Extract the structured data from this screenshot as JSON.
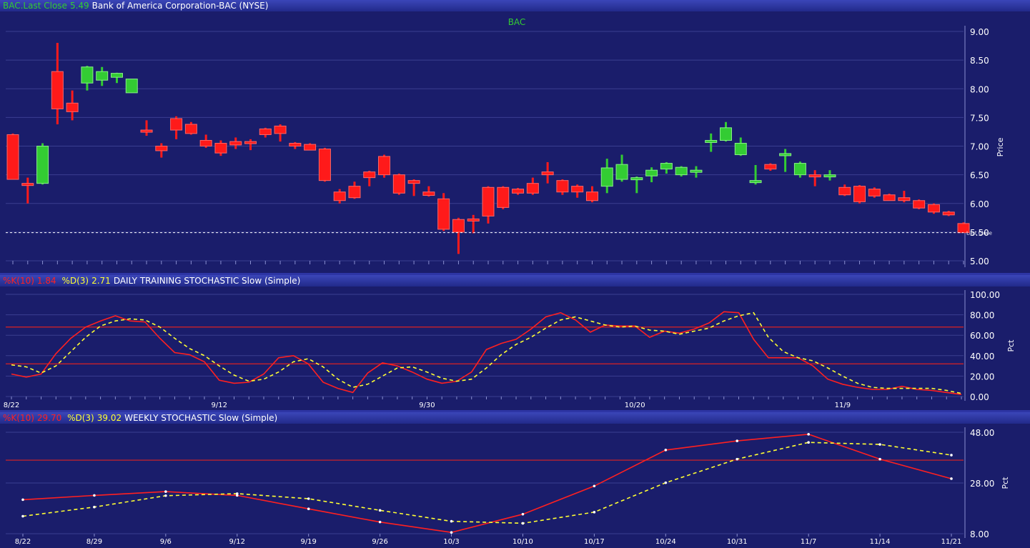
{
  "header": {
    "symbol_label": "BAC.Last Close",
    "last_close": "5.49",
    "name": "Bank of America Corporation-BAC (NYSE)"
  },
  "colors": {
    "background": "#1a1d6b",
    "grid": "#3a3f90",
    "up": "#33cc33",
    "down": "#ff1a1a",
    "k_line": "#ff2020",
    "d_line": "#ffff33",
    "ref_line": "#dd2222"
  },
  "price_panel": {
    "title": "BAC",
    "y_axis_label": "Price",
    "last_close_label": "Last Close",
    "y_ticks": [
      "9.00",
      "8.50",
      "8.00",
      "7.50",
      "7.00",
      "6.50",
      "6.00",
      "5.50",
      "5.00"
    ]
  },
  "daily_panel": {
    "k_label": "%K(10)",
    "k_value": "1.84",
    "d_label": "%D(3)",
    "d_value": "2.71",
    "title": "DAILY TRAINING STOCHASTIC Slow (Simple)",
    "y_axis_label": "Pct",
    "y_ticks": [
      "100.00",
      "80.00",
      "60.00",
      "40.00",
      "20.00",
      "0.00"
    ],
    "x_ticks": [
      "8/22",
      "9/12",
      "9/30",
      "10/20",
      "11/9"
    ]
  },
  "weekly_panel": {
    "k_label": "%K(10)",
    "k_value": "29.70",
    "d_label": "%D(3)",
    "d_value": "39.02",
    "title": "WEEKLY STOCHASTIC Slow (Simple)",
    "y_axis_label": "Pct",
    "y_ticks": [
      "48.00",
      "28.00",
      "8.00"
    ],
    "x_ticks": [
      "8/22",
      "8/29",
      "9/6",
      "9/12",
      "9/19",
      "9/26",
      "10/3",
      "10/10",
      "10/17",
      "10/24",
      "10/31",
      "11/7",
      "11/14",
      "11/21"
    ]
  },
  "chart_data": [
    {
      "type": "candlestick",
      "title": "BAC",
      "ylabel": "Price",
      "ylim": [
        5.0,
        9.0
      ],
      "last_close": 5.49,
      "grid": true,
      "candles": [
        {
          "o": 7.2,
          "h": 7.22,
          "l": 6.42,
          "c": 6.42
        },
        {
          "o": 6.35,
          "h": 6.45,
          "l": 6.0,
          "c": 6.32
        },
        {
          "o": 6.35,
          "h": 7.05,
          "l": 6.33,
          "c": 7.0
        },
        {
          "o": 8.3,
          "h": 8.8,
          "l": 7.38,
          "c": 7.65
        },
        {
          "o": 7.75,
          "h": 7.97,
          "l": 7.45,
          "c": 7.6
        },
        {
          "o": 8.1,
          "h": 8.4,
          "l": 7.97,
          "c": 8.38
        },
        {
          "o": 8.15,
          "h": 8.38,
          "l": 8.05,
          "c": 8.3
        },
        {
          "o": 8.2,
          "h": 8.28,
          "l": 8.1,
          "c": 8.27
        },
        {
          "o": 7.93,
          "h": 8.17,
          "l": 7.93,
          "c": 8.17
        },
        {
          "o": 7.28,
          "h": 7.45,
          "l": 7.18,
          "c": 7.25
        },
        {
          "o": 7.0,
          "h": 7.05,
          "l": 6.8,
          "c": 6.92
        },
        {
          "o": 7.48,
          "h": 7.52,
          "l": 7.12,
          "c": 7.28
        },
        {
          "o": 7.38,
          "h": 7.42,
          "l": 7.2,
          "c": 7.22
        },
        {
          "o": 7.1,
          "h": 7.2,
          "l": 6.97,
          "c": 7.0
        },
        {
          "o": 7.05,
          "h": 7.1,
          "l": 6.83,
          "c": 6.88
        },
        {
          "o": 7.08,
          "h": 7.15,
          "l": 6.95,
          "c": 7.02
        },
        {
          "o": 7.08,
          "h": 7.12,
          "l": 6.93,
          "c": 7.05
        },
        {
          "o": 7.3,
          "h": 7.32,
          "l": 7.15,
          "c": 7.2
        },
        {
          "o": 7.35,
          "h": 7.38,
          "l": 7.08,
          "c": 7.22
        },
        {
          "o": 7.05,
          "h": 7.07,
          "l": 6.95,
          "c": 7.0
        },
        {
          "o": 7.03,
          "h": 7.05,
          "l": 6.93,
          "c": 6.93
        },
        {
          "o": 6.95,
          "h": 6.97,
          "l": 6.38,
          "c": 6.4
        },
        {
          "o": 6.2,
          "h": 6.25,
          "l": 6.0,
          "c": 6.05
        },
        {
          "o": 6.3,
          "h": 6.38,
          "l": 6.08,
          "c": 6.1
        },
        {
          "o": 6.55,
          "h": 6.57,
          "l": 6.3,
          "c": 6.45
        },
        {
          "o": 6.82,
          "h": 6.85,
          "l": 6.45,
          "c": 6.5
        },
        {
          "o": 6.5,
          "h": 6.52,
          "l": 6.15,
          "c": 6.18
        },
        {
          "o": 6.4,
          "h": 6.42,
          "l": 6.13,
          "c": 6.35
        },
        {
          "o": 6.2,
          "h": 6.3,
          "l": 6.12,
          "c": 6.14
        },
        {
          "o": 6.08,
          "h": 6.18,
          "l": 5.52,
          "c": 5.55
        },
        {
          "o": 5.72,
          "h": 5.75,
          "l": 5.12,
          "c": 5.5
        },
        {
          "o": 5.73,
          "h": 5.8,
          "l": 5.48,
          "c": 5.72
        },
        {
          "o": 6.28,
          "h": 6.3,
          "l": 5.65,
          "c": 5.78
        },
        {
          "o": 6.28,
          "h": 6.3,
          "l": 5.9,
          "c": 5.93
        },
        {
          "o": 6.25,
          "h": 6.27,
          "l": 6.15,
          "c": 6.18
        },
        {
          "o": 6.35,
          "h": 6.45,
          "l": 6.15,
          "c": 6.18
        },
        {
          "o": 6.55,
          "h": 6.72,
          "l": 6.35,
          "c": 6.5
        },
        {
          "o": 6.4,
          "h": 6.42,
          "l": 6.15,
          "c": 6.2
        },
        {
          "o": 6.3,
          "h": 6.33,
          "l": 6.1,
          "c": 6.2
        },
        {
          "o": 6.2,
          "h": 6.3,
          "l": 6.02,
          "c": 6.05
        },
        {
          "o": 6.3,
          "h": 6.78,
          "l": 6.18,
          "c": 6.62
        },
        {
          "o": 6.42,
          "h": 6.85,
          "l": 6.38,
          "c": 6.68
        },
        {
          "o": 6.45,
          "h": 6.47,
          "l": 6.18,
          "c": 6.45
        },
        {
          "o": 6.48,
          "h": 6.63,
          "l": 6.37,
          "c": 6.58
        },
        {
          "o": 6.6,
          "h": 6.72,
          "l": 6.52,
          "c": 6.7
        },
        {
          "o": 6.5,
          "h": 6.65,
          "l": 6.47,
          "c": 6.63
        },
        {
          "o": 6.55,
          "h": 6.65,
          "l": 6.45,
          "c": 6.58
        },
        {
          "o": 7.08,
          "h": 7.22,
          "l": 6.9,
          "c": 7.1
        },
        {
          "o": 7.1,
          "h": 7.42,
          "l": 7.08,
          "c": 7.32
        },
        {
          "o": 6.85,
          "h": 7.15,
          "l": 6.83,
          "c": 7.05
        },
        {
          "o": 6.4,
          "h": 6.67,
          "l": 6.33,
          "c": 6.4
        },
        {
          "o": 6.68,
          "h": 6.7,
          "l": 6.57,
          "c": 6.6
        },
        {
          "o": 6.85,
          "h": 6.95,
          "l": 6.55,
          "c": 6.87
        },
        {
          "o": 6.5,
          "h": 6.73,
          "l": 6.45,
          "c": 6.7
        },
        {
          "o": 6.5,
          "h": 6.58,
          "l": 6.3,
          "c": 6.48
        },
        {
          "o": 6.5,
          "h": 6.58,
          "l": 6.4,
          "c": 6.5
        },
        {
          "o": 6.28,
          "h": 6.33,
          "l": 6.13,
          "c": 6.15
        },
        {
          "o": 6.3,
          "h": 6.32,
          "l": 6.0,
          "c": 6.03
        },
        {
          "o": 6.25,
          "h": 6.28,
          "l": 6.1,
          "c": 6.13
        },
        {
          "o": 6.15,
          "h": 6.17,
          "l": 6.05,
          "c": 6.05
        },
        {
          "o": 6.1,
          "h": 6.22,
          "l": 6.02,
          "c": 6.05
        },
        {
          "o": 6.05,
          "h": 6.07,
          "l": 5.9,
          "c": 5.92
        },
        {
          "o": 5.98,
          "h": 6.0,
          "l": 5.82,
          "c": 5.85
        },
        {
          "o": 5.85,
          "h": 5.87,
          "l": 5.78,
          "c": 5.8
        },
        {
          "o": 5.65,
          "h": 5.67,
          "l": 5.49,
          "c": 5.49
        }
      ]
    },
    {
      "type": "line",
      "title": "DAILY TRAINING STOCHASTIC Slow (Simple)",
      "ylabel": "Pct",
      "ylim": [
        0,
        100
      ],
      "reference_lines": [
        68,
        32
      ],
      "series": [
        {
          "name": "%K(10)",
          "values": [
            22,
            19,
            22,
            42,
            57,
            68,
            74,
            79,
            74,
            73,
            57,
            43,
            41,
            34,
            16,
            13,
            14,
            22,
            38,
            40,
            32,
            14,
            8,
            4,
            23,
            33,
            30,
            24,
            17,
            13,
            15,
            24,
            46,
            52,
            56,
            66,
            78,
            82,
            75,
            63,
            70,
            69,
            69,
            58,
            64,
            62,
            66,
            72,
            83,
            82,
            56,
            38,
            38,
            38,
            30,
            17,
            12,
            9,
            7,
            7,
            10,
            7,
            6,
            4,
            2
          ]
        },
        {
          "name": "%D(3)",
          "values": [
            31,
            29,
            23,
            30,
            44,
            58,
            69,
            74,
            76,
            75,
            68,
            57,
            47,
            40,
            30,
            21,
            15,
            17,
            24,
            34,
            37,
            29,
            17,
            9,
            12,
            20,
            28,
            29,
            24,
            18,
            15,
            17,
            28,
            41,
            51,
            58,
            67,
            75,
            78,
            74,
            70,
            68,
            69,
            65,
            64,
            61,
            64,
            67,
            74,
            79,
            82,
            58,
            44,
            38,
            35,
            28,
            20,
            13,
            9,
            8,
            8,
            8,
            8,
            6,
            3
          ]
        }
      ]
    },
    {
      "type": "line",
      "title": "WEEKLY STOCHASTIC Slow (Simple)",
      "ylabel": "Pct",
      "ylim": [
        8,
        48
      ],
      "reference_line": 37,
      "categories": [
        "8/22",
        "8/29",
        "9/6",
        "9/12",
        "9/19",
        "9/26",
        "10/3",
        "10/10",
        "10/17",
        "10/24",
        "10/31",
        "11/7",
        "11/14",
        "11/21"
      ],
      "series": [
        {
          "name": "%K(10)",
          "values": [
            21.4,
            23.1,
            24.6,
            23.1,
            17.8,
            12.6,
            8.5,
            15.7,
            26.8,
            41.0,
            44.6,
            47.2,
            37.4,
            29.7
          ]
        },
        {
          "name": "%D(3)",
          "values": [
            14.9,
            18.5,
            23.0,
            23.8,
            21.8,
            17.2,
            12.9,
            12.1,
            16.5,
            28.1,
            37.4,
            44.0,
            43.2,
            39.0
          ]
        }
      ]
    }
  ]
}
